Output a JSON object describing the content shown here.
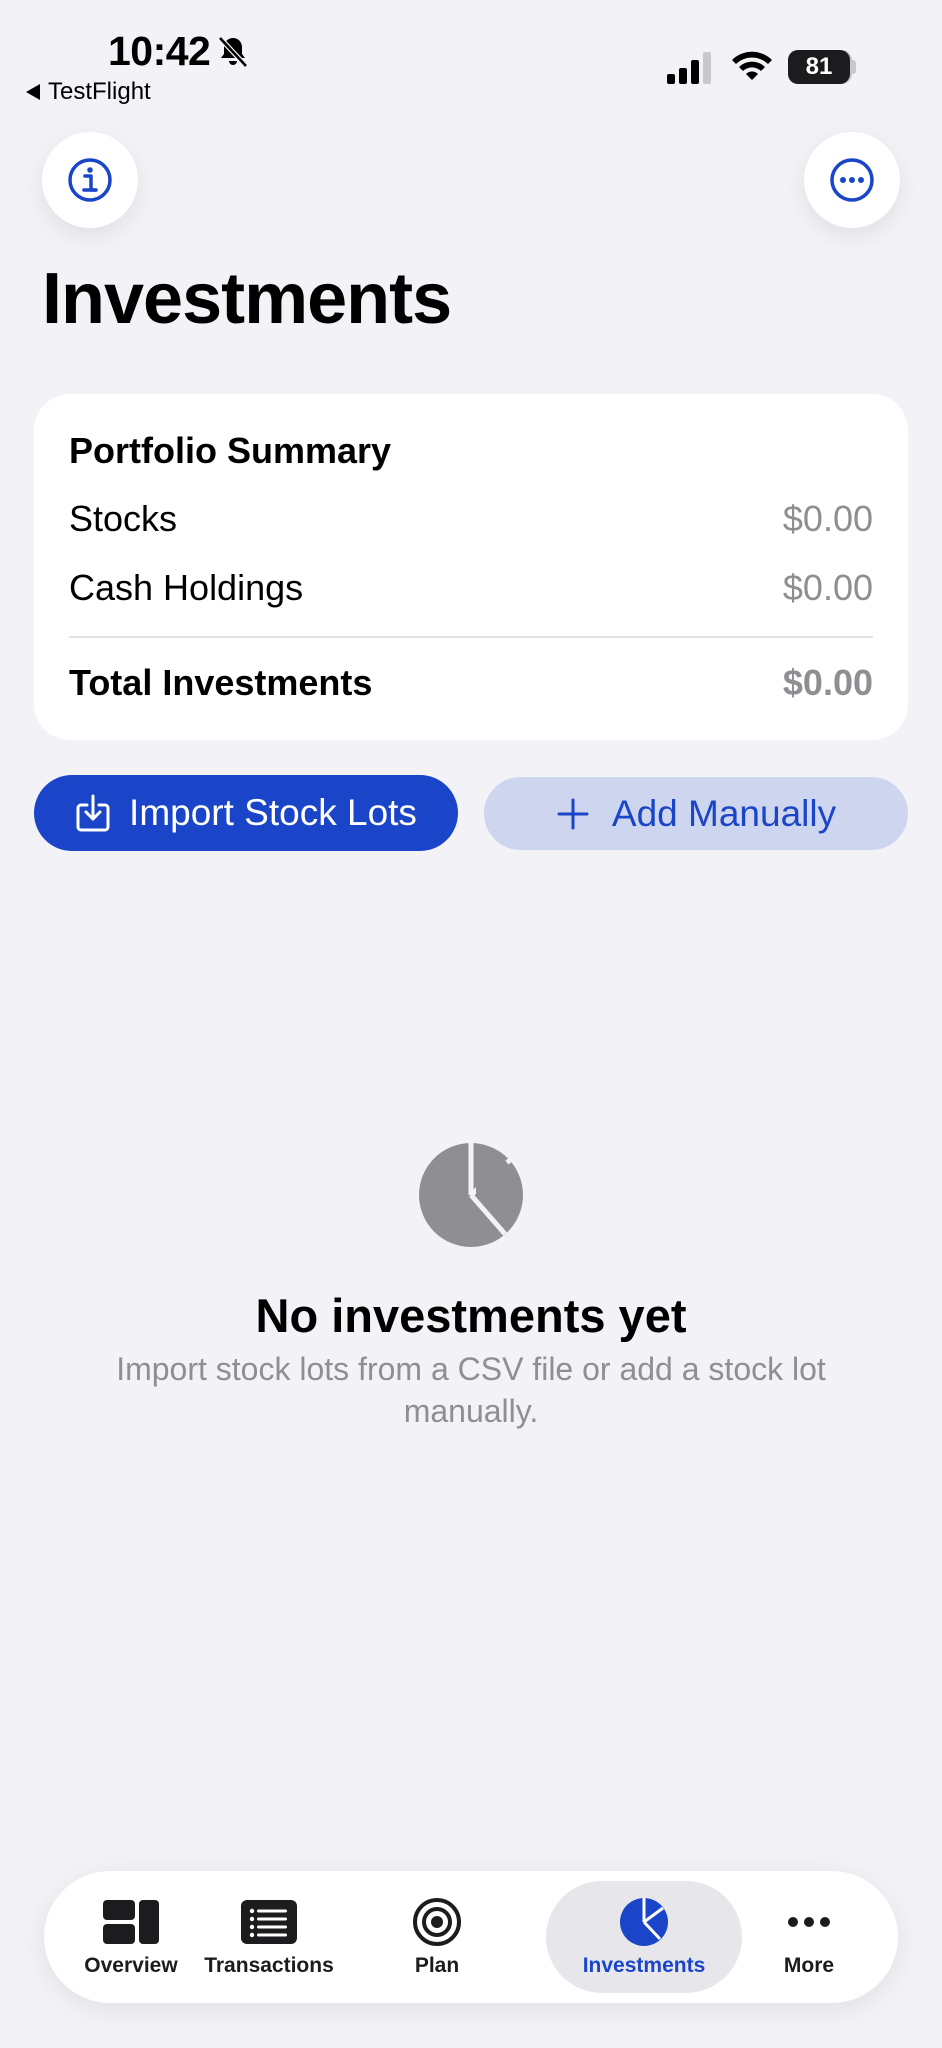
{
  "status_bar": {
    "time": "10:42",
    "back_app": "TestFlight",
    "battery": "81",
    "icons": [
      "bell-slash-icon",
      "cellular-signal-icon",
      "wifi-icon",
      "battery-icon"
    ]
  },
  "header": {
    "title": "Investments",
    "left_button_icon": "info-icon",
    "right_button_icon": "ellipsis-circle-icon"
  },
  "summary": {
    "title": "Portfolio Summary",
    "rows": [
      {
        "label": "Stocks",
        "value": "$0.00"
      },
      {
        "label": "Cash Holdings",
        "value": "$0.00"
      }
    ],
    "total": {
      "label": "Total Investments",
      "value": "$0.00"
    }
  },
  "actions": {
    "import_label": "Import Stock Lots",
    "import_icon": "tray-download-icon",
    "add_label": "Add Manually",
    "add_icon": "plus-icon"
  },
  "empty_state": {
    "icon": "pie-chart-icon",
    "title": "No investments yet",
    "subtitle": "Import stock lots from a CSV file or add a stock lot manually."
  },
  "tabs": [
    {
      "label": "Overview",
      "icon": "dashboard-icon"
    },
    {
      "label": "Transactions",
      "icon": "list-icon"
    },
    {
      "label": "Plan",
      "icon": "target-icon"
    },
    {
      "label": "Investments",
      "icon": "pie-chart-icon",
      "selected": true
    },
    {
      "label": "More",
      "icon": "ellipsis-icon"
    }
  ],
  "colors": {
    "accent": "#1a45c8",
    "background": "#f2f2f7",
    "secondary_text": "#8e8e93"
  }
}
